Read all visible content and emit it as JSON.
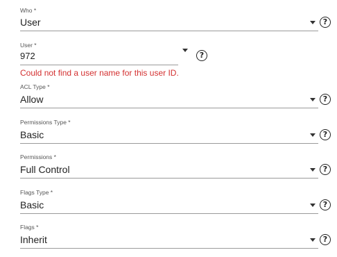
{
  "form": {
    "who": {
      "label": "Who *",
      "value": "User"
    },
    "user": {
      "label": "User *",
      "value": "972",
      "error": "Could not find a user name for this user ID."
    },
    "acl_type": {
      "label": "ACL Type *",
      "value": "Allow"
    },
    "permissions_type": {
      "label": "Permissions Type *",
      "value": "Basic"
    },
    "permissions": {
      "label": "Permissions *",
      "value": "Full Control"
    },
    "flags_type": {
      "label": "Flags Type *",
      "value": "Basic"
    },
    "flags": {
      "label": "Flags *",
      "value": "Inherit"
    }
  },
  "icons": {
    "dropdown": "arrow-drop-down-icon",
    "help": "help-outline-icon",
    "help_glyph": "?"
  },
  "colors": {
    "error": "#d32f2f",
    "underline": "#9a9a9a",
    "text": "#222222"
  }
}
